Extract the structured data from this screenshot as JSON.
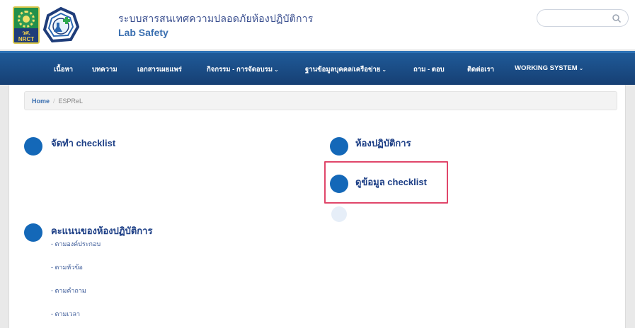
{
  "header": {
    "logo_text": "วศ.\nNRCT",
    "title_th": "ระบบสารสนเทศความปลอดภัยห้องปฏิบัติการ",
    "title_en": "Lab Safety",
    "search_placeholder": ""
  },
  "nav": {
    "items": [
      {
        "label": "เนื้อหา"
      },
      {
        "label": "บทความ"
      },
      {
        "label": "เอกสารเผยแพร่"
      },
      {
        "label": "กิจกรรม - การจัดอบรม",
        "dropdown": true
      },
      {
        "label": "ฐานข้อมูลบุคคล/เครือข่าย",
        "dropdown": true
      },
      {
        "label": "ถาม - ตอบ"
      },
      {
        "label": "ติดต่อเรา"
      },
      {
        "label": "WORKING SYSTEM",
        "dropdown": true
      }
    ],
    "chevron": "⌄"
  },
  "breadcrumb": {
    "home": "Home",
    "separator": "/",
    "current": "ESPReL"
  },
  "main": {
    "left_links": {
      "make_checklist": "จัดทำ checklist",
      "lab_score": "คะแนนของห้องปฏิบัติการ",
      "sub_items": [
        "- ตามองค์ประกอบ",
        "- ตามหัวข้อ",
        "- ตามคำถาม",
        "- ตามเวลา"
      ]
    },
    "right_links": {
      "labs": "ห้องปฏิบัติการ",
      "view_checklist": "ดูข้อมูล checklist"
    }
  },
  "colors": {
    "nav_bg": "#163f73",
    "link": "#1d3f86",
    "bullet": "#1468b8",
    "highlight": "#e0466a"
  }
}
